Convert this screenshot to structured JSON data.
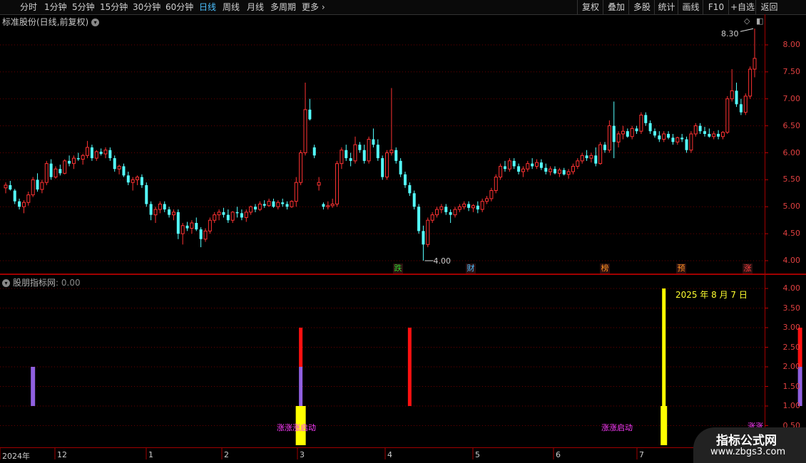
{
  "toolbar": {
    "periods": [
      "分时",
      "1分钟",
      "5分钟",
      "15分钟",
      "30分钟",
      "60分钟",
      "日线",
      "周线",
      "月线",
      "多周期",
      "更多"
    ],
    "active": "日线",
    "right_buttons": [
      "复权",
      "叠加",
      "多股",
      "统计",
      "画线",
      "F10",
      "+自选",
      "返回"
    ]
  },
  "main_title": "标准股份(日线,前复权)",
  "sub_title": "股朋指标网",
  "sub_value": ": 0.00",
  "date_label": "2025 年 8 月 7 日",
  "price_axis": [
    "8.00",
    "7.50",
    "7.00",
    "6.50",
    "6.00",
    "5.50",
    "5.00",
    "4.50",
    "4.00"
  ],
  "indicator_axis": [
    "4.00",
    "3.50",
    "3.00",
    "2.50",
    "2.00",
    "1.50",
    "1.00",
    "0.50"
  ],
  "high_label": "8.30",
  "low_label": "4.00",
  "events": [
    {
      "text": "跌",
      "color": "#30d030"
    },
    {
      "text": "财",
      "color": "#4cc0ff"
    },
    {
      "text": "榜",
      "color": "#ff9020"
    },
    {
      "text": "预",
      "color": "#ff9020"
    },
    {
      "text": "涨",
      "color": "#ff4040"
    }
  ],
  "signal_labels": [
    "涨涨涨启动",
    "涨涨启动",
    "涨涨"
  ],
  "time_axis": [
    "2024年",
    "12",
    "1",
    "2",
    "3",
    "4",
    "5",
    "6",
    "7"
  ],
  "watermark": {
    "title": "指标公式网",
    "url": "www.zbgs3.com"
  },
  "chart_data": {
    "type": "candlestick",
    "ylim": [
      3.9,
      8.4
    ],
    "candles": [
      [
        5.35,
        5.45,
        5.25,
        5.4
      ],
      [
        5.4,
        5.48,
        5.3,
        5.32
      ],
      [
        5.3,
        5.33,
        5.05,
        5.1
      ],
      [
        5.1,
        5.15,
        4.95,
        5.0
      ],
      [
        5.0,
        5.12,
        4.88,
        5.08
      ],
      [
        5.08,
        5.28,
        5.02,
        5.22
      ],
      [
        5.22,
        5.55,
        5.18,
        5.5
      ],
      [
        5.5,
        5.62,
        5.28,
        5.32
      ],
      [
        5.32,
        5.5,
        5.25,
        5.45
      ],
      [
        5.45,
        5.85,
        5.4,
        5.8
      ],
      [
        5.8,
        5.88,
        5.5,
        5.55
      ],
      [
        5.55,
        5.75,
        5.52,
        5.7
      ],
      [
        5.7,
        5.78,
        5.58,
        5.62
      ],
      [
        5.62,
        5.88,
        5.6,
        5.85
      ],
      [
        5.85,
        5.95,
        5.75,
        5.8
      ],
      [
        5.8,
        5.95,
        5.7,
        5.9
      ],
      [
        5.9,
        6.0,
        5.85,
        5.88
      ],
      [
        5.88,
        5.98,
        5.78,
        5.95
      ],
      [
        5.95,
        6.22,
        5.9,
        6.1
      ],
      [
        6.1,
        6.15,
        5.85,
        5.9
      ],
      [
        5.9,
        6.05,
        5.85,
        6.02
      ],
      [
        6.02,
        6.08,
        5.95,
        5.98
      ],
      [
        5.98,
        6.1,
        5.9,
        6.05
      ],
      [
        6.05,
        6.1,
        5.85,
        5.9
      ],
      [
        5.9,
        5.95,
        5.65,
        5.7
      ],
      [
        5.7,
        5.78,
        5.6,
        5.75
      ],
      [
        5.75,
        5.8,
        5.55,
        5.58
      ],
      [
        5.58,
        5.65,
        5.4,
        5.45
      ],
      [
        5.45,
        5.55,
        5.3,
        5.5
      ],
      [
        5.5,
        5.58,
        5.4,
        5.55
      ],
      [
        5.55,
        5.6,
        5.35,
        5.4
      ],
      [
        5.4,
        5.45,
        5.0,
        5.05
      ],
      [
        5.05,
        5.1,
        4.75,
        4.85
      ],
      [
        4.85,
        5.0,
        4.7,
        4.95
      ],
      [
        4.95,
        5.1,
        4.88,
        5.05
      ],
      [
        5.05,
        5.1,
        4.9,
        4.95
      ],
      [
        4.95,
        5.0,
        4.8,
        4.85
      ],
      [
        4.85,
        4.95,
        4.75,
        4.9
      ],
      [
        4.9,
        4.95,
        4.4,
        4.5
      ],
      [
        4.5,
        4.7,
        4.3,
        4.65
      ],
      [
        4.65,
        4.72,
        4.55,
        4.6
      ],
      [
        4.6,
        4.75,
        4.5,
        4.7
      ],
      [
        4.7,
        4.8,
        4.55,
        4.58
      ],
      [
        4.58,
        4.62,
        4.25,
        4.4
      ],
      [
        4.4,
        4.6,
        4.35,
        4.55
      ],
      [
        4.55,
        4.8,
        4.5,
        4.75
      ],
      [
        4.75,
        4.9,
        4.7,
        4.85
      ],
      [
        4.85,
        4.95,
        4.75,
        4.9
      ],
      [
        4.9,
        4.98,
        4.8,
        4.85
      ],
      [
        4.85,
        4.95,
        4.7,
        4.75
      ],
      [
        4.75,
        4.92,
        4.7,
        4.9
      ],
      [
        4.9,
        5.0,
        4.8,
        4.88
      ],
      [
        4.88,
        4.95,
        4.75,
        4.8
      ],
      [
        4.8,
        4.95,
        4.72,
        4.9
      ],
      [
        4.9,
        5.02,
        4.85,
        5.0
      ],
      [
        5.0,
        5.05,
        4.9,
        4.95
      ],
      [
        4.95,
        5.1,
        4.92,
        5.05
      ],
      [
        5.05,
        5.12,
        4.98,
        5.02
      ],
      [
        5.02,
        5.15,
        5.0,
        5.1
      ],
      [
        5.1,
        5.15,
        4.98,
        5.0
      ],
      [
        5.0,
        5.12,
        4.95,
        5.08
      ],
      [
        5.08,
        5.15,
        5.0,
        5.05
      ],
      [
        5.05,
        5.1,
        4.95,
        5.0
      ],
      [
        5.0,
        5.12,
        4.98,
        5.1
      ],
      [
        5.1,
        5.55,
        5.0,
        5.45
      ],
      [
        5.45,
        6.05,
        5.4,
        6.0
      ],
      [
        6.0,
        7.3,
        5.95,
        6.8
      ],
      [
        6.8,
        7.0,
        6.6,
        6.62
      ],
      [
        6.1,
        6.15,
        5.9,
        5.95
      ],
      [
        5.4,
        5.55,
        5.3,
        5.45
      ],
      [
        5.05,
        5.08,
        4.95,
        5.0
      ],
      [
        5.0,
        5.1,
        4.95,
        5.02
      ],
      [
        5.02,
        5.15,
        4.98,
        5.05
      ],
      [
        5.05,
        5.85,
        5.0,
        5.8
      ],
      [
        5.8,
        6.1,
        5.7,
        6.05
      ],
      [
        6.05,
        6.15,
        5.85,
        5.9
      ],
      [
        5.9,
        6.0,
        5.75,
        5.85
      ],
      [
        5.85,
        6.3,
        5.8,
        6.15
      ],
      [
        6.15,
        6.2,
        6.0,
        6.05
      ],
      [
        6.05,
        6.15,
        5.8,
        5.85
      ],
      [
        5.85,
        6.3,
        5.8,
        6.25
      ],
      [
        6.25,
        6.45,
        6.1,
        6.15
      ],
      [
        6.15,
        6.25,
        5.85,
        5.9
      ],
      [
        5.9,
        5.95,
        5.5,
        5.55
      ],
      [
        5.55,
        6.05,
        5.5,
        6.0
      ],
      [
        6.0,
        7.2,
        5.95,
        6.05
      ],
      [
        6.05,
        6.1,
        5.8,
        5.85
      ],
      [
        5.85,
        5.9,
        5.55,
        5.6
      ],
      [
        5.6,
        5.65,
        5.35,
        5.4
      ],
      [
        5.4,
        5.45,
        5.2,
        5.25
      ],
      [
        5.25,
        5.3,
        4.95,
        5.0
      ],
      [
        5.0,
        5.05,
        4.5,
        4.55
      ],
      [
        4.55,
        4.65,
        4.0,
        4.3
      ],
      [
        4.3,
        4.8,
        4.25,
        4.75
      ],
      [
        4.75,
        4.9,
        4.7,
        4.85
      ],
      [
        4.85,
        5.0,
        4.8,
        4.95
      ],
      [
        4.95,
        5.05,
        4.88,
        5.0
      ],
      [
        5.0,
        5.05,
        4.85,
        4.9
      ],
      [
        4.9,
        4.95,
        4.7,
        4.85
      ],
      [
        4.85,
        5.0,
        4.8,
        4.95
      ],
      [
        4.95,
        5.05,
        4.9,
        5.0
      ],
      [
        5.0,
        5.1,
        4.95,
        5.05
      ],
      [
        5.05,
        5.1,
        4.92,
        4.98
      ],
      [
        4.98,
        5.05,
        4.9,
        5.02
      ],
      [
        5.02,
        5.1,
        4.88,
        4.95
      ],
      [
        4.95,
        5.15,
        4.9,
        5.1
      ],
      [
        5.1,
        5.2,
        5.05,
        5.15
      ],
      [
        5.15,
        5.35,
        5.1,
        5.3
      ],
      [
        5.3,
        5.6,
        5.25,
        5.55
      ],
      [
        5.55,
        5.8,
        5.5,
        5.75
      ],
      [
        5.75,
        5.85,
        5.65,
        5.7
      ],
      [
        5.7,
        5.9,
        5.65,
        5.85
      ],
      [
        5.85,
        5.9,
        5.7,
        5.75
      ],
      [
        5.75,
        5.8,
        5.6,
        5.65
      ],
      [
        5.65,
        5.75,
        5.55,
        5.7
      ],
      [
        5.7,
        5.85,
        5.65,
        5.8
      ],
      [
        5.8,
        5.9,
        5.7,
        5.75
      ],
      [
        5.75,
        5.88,
        5.7,
        5.82
      ],
      [
        5.82,
        5.88,
        5.68,
        5.72
      ],
      [
        5.72,
        5.8,
        5.6,
        5.65
      ],
      [
        5.65,
        5.75,
        5.58,
        5.7
      ],
      [
        5.7,
        5.75,
        5.6,
        5.62
      ],
      [
        5.62,
        5.72,
        5.55,
        5.68
      ],
      [
        5.68,
        5.72,
        5.58,
        5.6
      ],
      [
        5.6,
        5.7,
        5.52,
        5.65
      ],
      [
        5.65,
        5.8,
        5.6,
        5.75
      ],
      [
        5.75,
        5.9,
        5.7,
        5.85
      ],
      [
        5.85,
        6.0,
        5.8,
        5.95
      ],
      [
        5.95,
        6.05,
        5.85,
        5.9
      ],
      [
        5.9,
        6.0,
        5.82,
        5.95
      ],
      [
        5.95,
        6.1,
        5.75,
        5.8
      ],
      [
        5.8,
        6.2,
        5.78,
        6.15
      ],
      [
        6.15,
        6.2,
        6.0,
        6.05
      ],
      [
        6.05,
        6.6,
        6.0,
        6.5
      ],
      [
        6.5,
        6.95,
        5.9,
        6.2
      ],
      [
        6.2,
        6.4,
        6.1,
        6.35
      ],
      [
        6.35,
        6.5,
        6.25,
        6.4
      ],
      [
        6.4,
        6.45,
        6.28,
        6.3
      ],
      [
        6.3,
        6.5,
        6.25,
        6.45
      ],
      [
        6.45,
        6.5,
        6.35,
        6.4
      ],
      [
        6.4,
        6.75,
        6.35,
        6.7
      ],
      [
        6.7,
        6.75,
        6.5,
        6.55
      ],
      [
        6.55,
        6.6,
        6.35,
        6.4
      ],
      [
        6.4,
        6.45,
        6.28,
        6.32
      ],
      [
        6.32,
        6.4,
        6.2,
        6.25
      ],
      [
        6.25,
        6.4,
        6.2,
        6.35
      ],
      [
        6.35,
        6.4,
        6.25,
        6.28
      ],
      [
        6.28,
        6.35,
        6.15,
        6.2
      ],
      [
        6.2,
        6.3,
        6.15,
        6.28
      ],
      [
        6.28,
        6.35,
        6.2,
        6.25
      ],
      [
        6.25,
        6.3,
        6.0,
        6.05
      ],
      [
        6.05,
        6.4,
        6.0,
        6.35
      ],
      [
        6.35,
        6.55,
        6.3,
        6.5
      ],
      [
        6.5,
        6.55,
        6.35,
        6.4
      ],
      [
        6.4,
        6.48,
        6.3,
        6.35
      ],
      [
        6.35,
        6.45,
        6.28,
        6.3
      ],
      [
        6.3,
        6.4,
        6.25,
        6.35
      ],
      [
        6.35,
        6.42,
        6.25,
        6.3
      ],
      [
        6.3,
        6.4,
        6.25,
        6.38
      ],
      [
        6.38,
        7.05,
        6.35,
        7.0
      ],
      [
        7.0,
        7.55,
        6.95,
        7.15
      ],
      [
        7.15,
        7.3,
        6.85,
        6.9
      ],
      [
        6.9,
        7.0,
        6.7,
        6.75
      ],
      [
        6.75,
        7.1,
        6.7,
        7.05
      ],
      [
        7.05,
        7.6,
        7.0,
        7.55
      ],
      [
        7.55,
        8.3,
        7.4,
        7.75
      ]
    ],
    "indicator_bars": [
      {
        "index": 6,
        "base": 1,
        "top": 2,
        "color": "#9060e0",
        "width": 6
      },
      {
        "index": 65,
        "base": 1,
        "top": 2,
        "color": "#9060e0",
        "width": 5
      },
      {
        "index": 65,
        "base": 2,
        "top": 3,
        "color": "#ff1010",
        "width": 5
      },
      {
        "index": 65,
        "base": 0,
        "top": 1,
        "color": "#ffff00",
        "width": 14
      },
      {
        "index": 89,
        "base": 1,
        "top": 3,
        "color": "#ff1010",
        "width": 5
      },
      {
        "index": 145,
        "base": 1,
        "top": 4,
        "color": "#ffff00",
        "width": 5
      },
      {
        "index": 145,
        "base": 0,
        "top": 1,
        "color": "#ffff00",
        "width": 9
      },
      {
        "index": 175,
        "base": 1,
        "top": 2,
        "color": "#9060e0",
        "width": 6
      },
      {
        "index": 175,
        "base": 2,
        "top": 3,
        "color": "#ff1010",
        "width": 6
      },
      {
        "index": 179,
        "base": 0,
        "top": 1,
        "color": "#ffff00",
        "width": 9
      }
    ]
  }
}
